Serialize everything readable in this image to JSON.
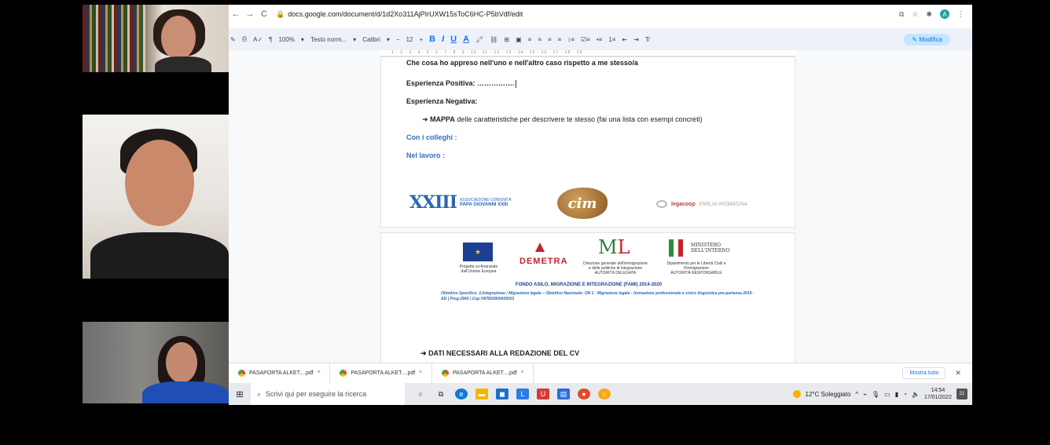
{
  "browser": {
    "url": "docs.google.com/document/d/1d2Xo311AjPIrUXW15sToC6HC-P5bVdf/edit",
    "nav_back": "←",
    "nav_forward": "→",
    "nav_reload": "C",
    "ext_avatar_letter": "A"
  },
  "toolbar": {
    "zoom": "100%",
    "style": "Testo norm...",
    "font": "Calibri",
    "font_size": "12",
    "bold": "B",
    "italic": "I",
    "underline": "U",
    "text_color": "A",
    "edit_mode": "Modifica"
  },
  "ruler": "1 · 2 · 3 · 4 · 5 · 6 · 7 · 8 · 9 · 10 · 11 · 12 · 13 · 14 · 15 · 16 · 17 · 18 · 19",
  "document": {
    "line1": "Che cosa ho appreso nell'uno e nell'altro caso rispetto a me stesso/a",
    "positiva_label": "Esperienza Positiva: …………….",
    "negativa_label": "Esperienza Negativa:",
    "mappa_arrow": "➜",
    "mappa_bold": "MAPPA",
    "mappa_rest": "delle caratteristiche per descrivere te stesso (fai una lista con esempi concreti)",
    "colleghi": "Con i colleghi :",
    "lavoro": "Nel lavoro :",
    "logos": {
      "xxiii": "XXIII",
      "xxiii_line1": "ASSOCIAZIONE COMUNITÀ",
      "xxiii_line2": "PAPA GIOVANNI XXIII",
      "cim": "cim",
      "legacoop": "legacoop",
      "legacoop_region": "EMILIA-ROMAGNA"
    },
    "page2": {
      "eu_caption_1": "Progetto co-finanziato",
      "eu_caption_2": "dall'Unione Europea",
      "demetra": "DEMETRA",
      "ml_caption_1": "Direzione generale dell'immigrazione",
      "ml_caption_2": "e delle politiche di integrazione",
      "ml_caption_3": "AUTORITÀ DELEGATA",
      "ministero_1": "MINISTERO",
      "ministero_2": "DELL'INTERNO",
      "min_caption_1": "Dipartimento per le Libertà Civili e",
      "min_caption_2": "l'Immigrazione",
      "min_caption_3": "AUTORITÀ RESPONSABILE",
      "fondo": "FONDO ASILO, MIGRAZIONE E INTEGRAZIONE (FAMI) 2014-2020",
      "obiettivo": "Obiettivo Specifico: 2.Integrazione / Migrazione legale – Obiettivo Nazionale: ON 1 - Migrazione legale - formazione professionale e civico linguistica pre-partenza 2019 - AD | Prog-2942 | Cup H67820000430001",
      "dati_arrow": "➜",
      "dati": "DATI NECESSARI ALLA REDAZIONE DEL CV"
    }
  },
  "downloads": {
    "items": [
      "PASAPORTA ALKET....pdf",
      "PASAPORTA ALKET....pdf",
      "PASAPORTA ALKET....pdf"
    ],
    "chevron": "^",
    "show_all": "Mostra tutto",
    "close": "✕"
  },
  "taskbar": {
    "search_placeholder": "Scrivi qui per eseguire la ricerca",
    "weather": "12°C Soleggiato",
    "time": "14:54",
    "date": "17/01/2022",
    "notifications": "21"
  },
  "colors": {
    "accent_blue": "#1a73e8",
    "doc_heading_blue": "#2f72b8"
  }
}
